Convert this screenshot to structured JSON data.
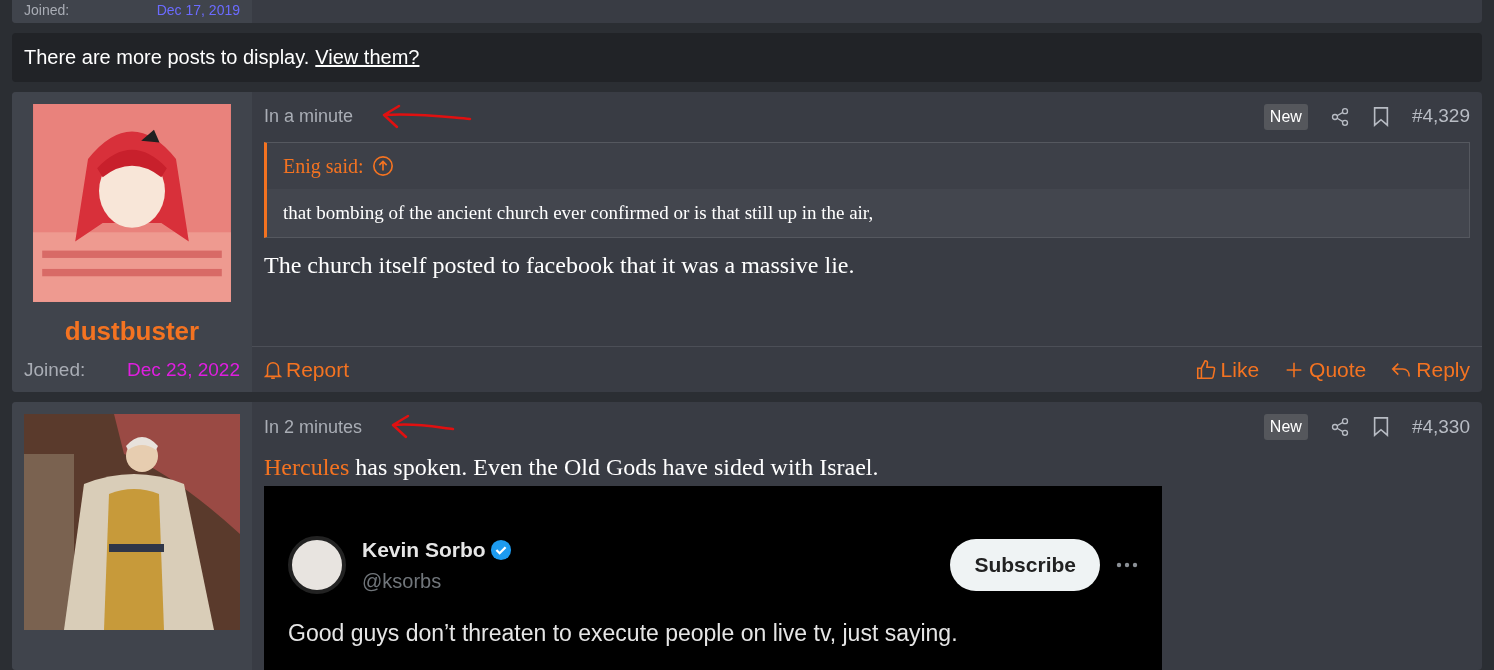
{
  "previous_post": {
    "joined_label": "Joined:",
    "joined_date": "Dec 17, 2019",
    "color": "#6b6bff"
  },
  "notice": {
    "text": "There are more posts to display.",
    "link": "View them?"
  },
  "posts": [
    {
      "time": "In a minute",
      "annotated": true,
      "new_badge": "New",
      "number": "#4,329",
      "username": "dustbuster",
      "joined_label": "Joined:",
      "joined_date": "Dec 23, 2022",
      "color": "#e01ee0",
      "avatar": {
        "kind": "anime"
      },
      "quote": {
        "author": "Enig said:",
        "text": "that bombing of the ancient church ever confirmed or is that still up in the air,"
      },
      "body": {
        "text": "The church itself posted to facebook that it was a massive lie."
      },
      "footer": {
        "report": "Report",
        "actions": [
          {
            "kind": "like",
            "label": "Like"
          },
          {
            "kind": "quote",
            "label": "Quote"
          },
          {
            "kind": "reply",
            "label": "Reply"
          }
        ]
      }
    },
    {
      "time": "In 2 minutes",
      "annotated": true,
      "new_badge": "New",
      "number": "#4,330",
      "avatar": {
        "kind": "portrait"
      },
      "body": {
        "mention": "Hercules",
        "text": " has spoken. Even the Old Gods have sided with Israel."
      },
      "embed": {
        "name": "Kevin Sorbo",
        "handle": "@ksorbs",
        "button": "Subscribe",
        "text": "Good guys don’t threaten to execute people on live tv, just saying."
      }
    }
  ]
}
